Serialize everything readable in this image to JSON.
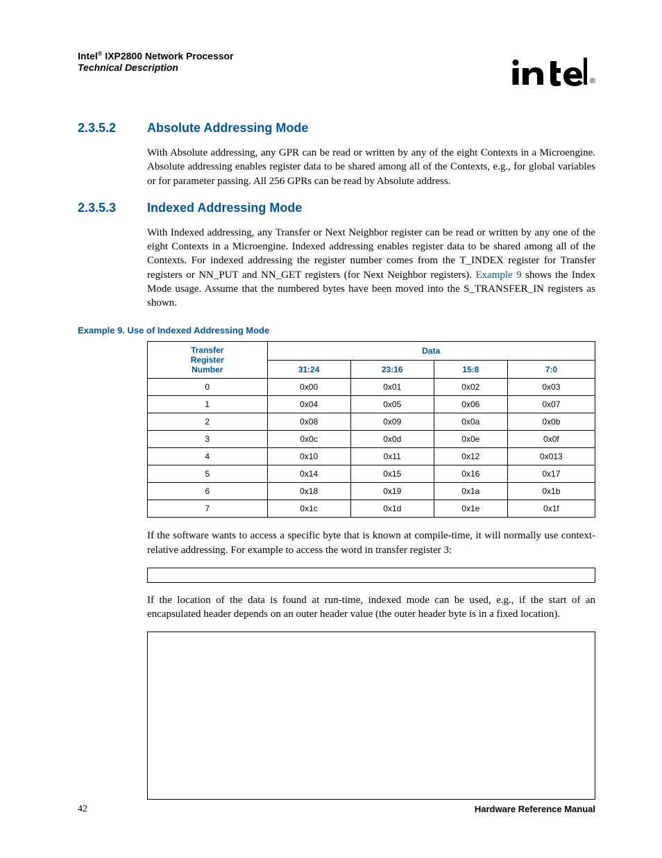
{
  "header": {
    "product_prefix": "Intel",
    "registered": "®",
    "product_suffix": " IXP2800 Network Processor",
    "subtitle": "Technical Description",
    "logo_text": "intel",
    "logo_reg": "®"
  },
  "sections": {
    "s2352": {
      "num": "2.3.5.2",
      "title": "Absolute Addressing Mode",
      "body": "With Absolute addressing, any GPR can be read or written by any of the eight Contexts in a Microengine. Absolute addressing enables register data to be shared among all of the Contexts, e.g., for global variables or for parameter passing. All 256 GPRs can be read by Absolute address."
    },
    "s2353": {
      "num": "2.3.5.3",
      "title": "Indexed Addressing Mode",
      "body_before_link": "With Indexed addressing, any Transfer or Next Neighbor register can be read or written by any one of the eight Contexts in a Microengine. Indexed addressing enables register data to be shared among all of the Contexts. For indexed addressing the register number comes from the T_INDEX register for Transfer registers or NN_PUT and NN_GET registers (for Next Neighbor registers). ",
      "link_text": "Example 9",
      "body_after_link": " shows the Index Mode usage. Assume that the numbered bytes have been moved into the S_TRANSFER_IN registers as shown."
    }
  },
  "example": {
    "title": "Example 9. Use of Indexed Addressing Mode",
    "col1_header_l1": "Transfer",
    "col1_header_l2": "Register",
    "col1_header_l3": "Number",
    "data_header": "Data",
    "chart_data": {
      "type": "table",
      "columns": [
        "Transfer Register Number",
        "31:24",
        "23:16",
        "15:8",
        "7:0"
      ],
      "sub_headers": [
        "31:24",
        "23:16",
        "15:8",
        "7:0"
      ],
      "rows": [
        {
          "n": "0",
          "c": [
            "0x00",
            "0x01",
            "0x02",
            "0x03"
          ]
        },
        {
          "n": "1",
          "c": [
            "0x04",
            "0x05",
            "0x06",
            "0x07"
          ]
        },
        {
          "n": "2",
          "c": [
            "0x08",
            "0x09",
            "0x0a",
            "0x0b"
          ]
        },
        {
          "n": "3",
          "c": [
            "0x0c",
            "0x0d",
            "0x0e",
            "0x0f"
          ]
        },
        {
          "n": "4",
          "c": [
            "0x10",
            "0x11",
            "0x12",
            "0x013"
          ]
        },
        {
          "n": "5",
          "c": [
            "0x14",
            "0x15",
            "0x16",
            "0x17"
          ]
        },
        {
          "n": "6",
          "c": [
            "0x18",
            "0x19",
            "0x1a",
            "0x1b"
          ]
        },
        {
          "n": "7",
          "c": [
            "0x1c",
            "0x1d",
            "0x1e",
            "0x1f"
          ]
        }
      ]
    }
  },
  "after_text_1": "If the software wants to access a specific byte that is known at compile-time, it will normally use context-relative addressing. For example to access the word in transfer register 3:",
  "after_text_2": "If the location of the data is found at run-time, indexed mode can be used, e.g., if the start of an encapsulated header depends on an outer header value (the outer header byte is in a fixed location).",
  "footer": {
    "page": "42",
    "manual": "Hardware Reference Manual"
  }
}
